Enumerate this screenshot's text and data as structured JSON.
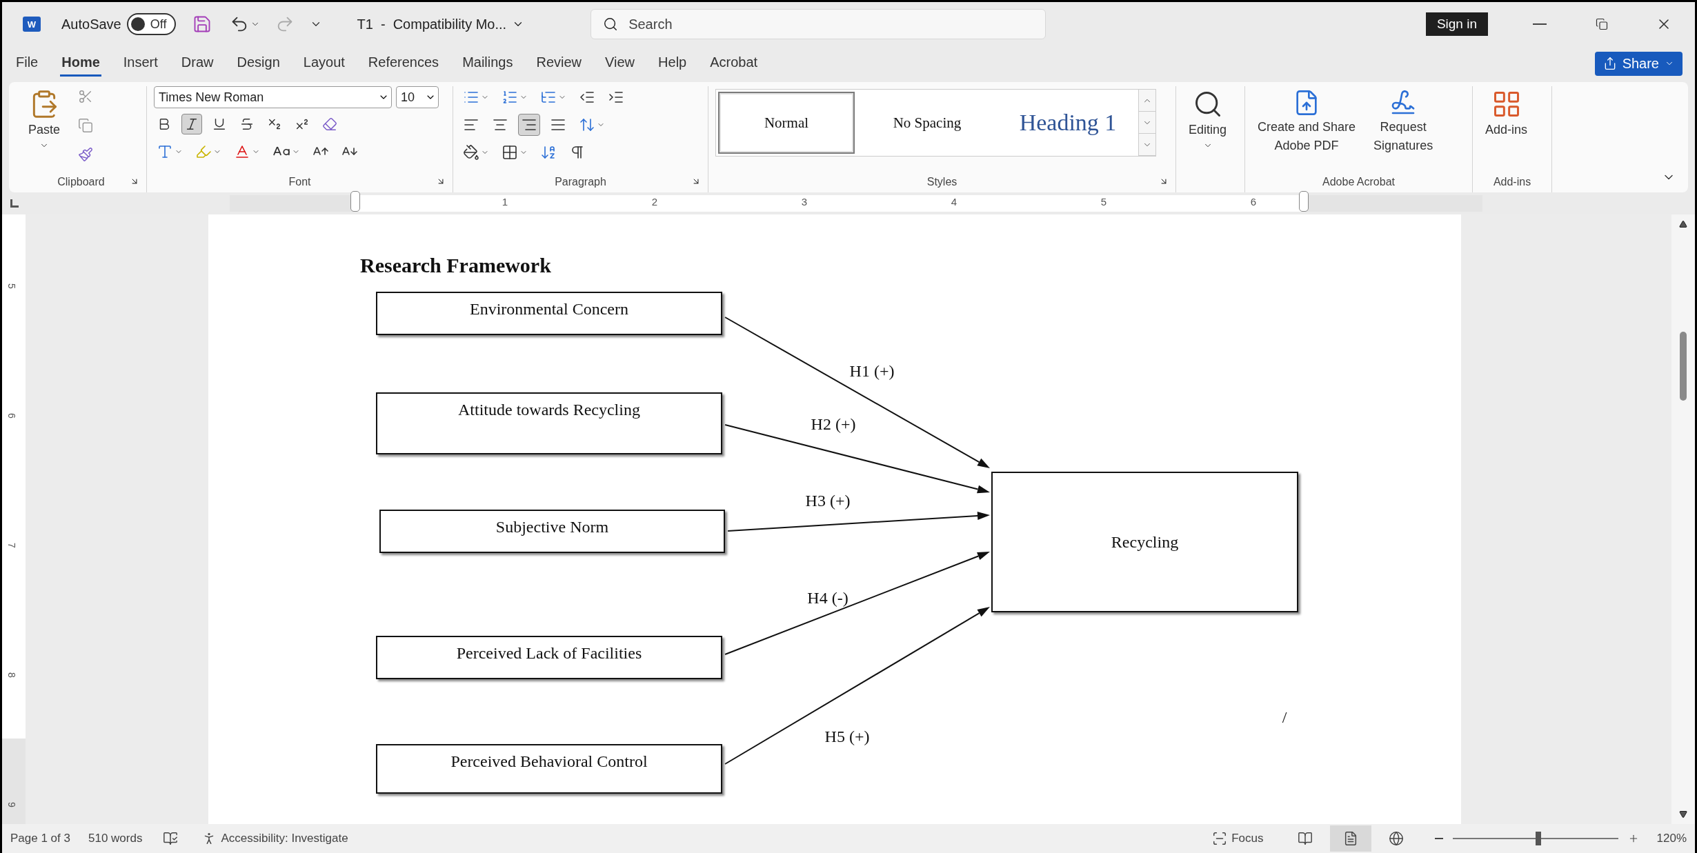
{
  "title_bar": {
    "app_logo_letter": "W",
    "autosave": {
      "label": "AutoSave",
      "state_text": "Off",
      "on": false
    },
    "document_title": "T1  -  Compatibility Mo...",
    "search": {
      "placeholder": "Search"
    },
    "sign_in": "Sign in"
  },
  "tabs": [
    {
      "label": "File",
      "selected": false
    },
    {
      "label": "Home",
      "selected": true
    },
    {
      "label": "Insert",
      "selected": false
    },
    {
      "label": "Draw",
      "selected": false
    },
    {
      "label": "Design",
      "selected": false
    },
    {
      "label": "Layout",
      "selected": false
    },
    {
      "label": "References",
      "selected": false
    },
    {
      "label": "Mailings",
      "selected": false
    },
    {
      "label": "Review",
      "selected": false
    },
    {
      "label": "View",
      "selected": false
    },
    {
      "label": "Help",
      "selected": false
    },
    {
      "label": "Acrobat",
      "selected": false
    }
  ],
  "share": "Share",
  "ribbon": {
    "clipboard": {
      "paste": "Paste",
      "label": "Clipboard"
    },
    "font": {
      "font_name": "Times New Roman",
      "font_size": "10",
      "label": "Font",
      "format_buttons": [
        {
          "kind": "bold",
          "pressed": false
        },
        {
          "kind": "italic",
          "pressed": true
        },
        {
          "kind": "underline",
          "pressed": false
        },
        {
          "kind": "strikethrough",
          "pressed": false
        },
        {
          "kind": "subscript",
          "pressed": false
        },
        {
          "kind": "superscript",
          "pressed": false
        }
      ]
    },
    "paragraph": {
      "label": "Paragraph",
      "align_buttons": [
        {
          "kind": "left",
          "pressed": false
        },
        {
          "kind": "center",
          "pressed": false
        },
        {
          "kind": "right",
          "pressed": true
        },
        {
          "kind": "justify",
          "pressed": false
        }
      ]
    },
    "styles": {
      "label": "Styles",
      "items": [
        {
          "label": "Normal",
          "kind": "normal",
          "selected": true
        },
        {
          "label": "No Spacing",
          "kind": "no_spacing",
          "selected": false
        },
        {
          "label": "Heading 1",
          "kind": "heading",
          "selected": false
        }
      ]
    },
    "editing": {
      "label": "Editing"
    },
    "adobe_acrobat": {
      "label": "Adobe Acrobat",
      "buttons": [
        {
          "kind": "pdf",
          "label_lines": [
            "Create and Share",
            "Adobe PDF"
          ]
        },
        {
          "kind": "signature",
          "label_lines": [
            "Request",
            "Signatures"
          ]
        }
      ]
    },
    "add_ins": {
      "button": "Add-ins",
      "label": "Add-ins"
    }
  },
  "ruler": {
    "numbers": [
      "1",
      "2",
      "3",
      "4",
      "5",
      "6"
    ]
  },
  "vertical_ruler": {
    "numbers": [
      "5",
      "6",
      "7",
      "8",
      "9"
    ]
  },
  "document": {
    "heading": "Research Framework",
    "diagram": {
      "nodes": [
        {
          "label": "Environmental Concern",
          "kind": "factor"
        },
        {
          "label": "Attitude towards Recycling",
          "kind": "factor"
        },
        {
          "label": "Subjective Norm",
          "kind": "factor"
        },
        {
          "label": "Perceived Lack of Facilities",
          "kind": "factor"
        },
        {
          "label": "Perceived Behavioral Control",
          "kind": "factor"
        },
        {
          "label": "Recycling",
          "kind": "outcome"
        }
      ],
      "hypotheses": [
        {
          "label": "H1 (+)"
        },
        {
          "label": "H2 (+)"
        },
        {
          "label": "H3 (+)"
        },
        {
          "label": "H4 (-)"
        },
        {
          "label": "H5 (+)"
        }
      ],
      "stray_mark": "/"
    }
  },
  "status_bar": {
    "page": "Page 1 of 3",
    "words": "510 words",
    "accessibility": "Accessibility: Investigate",
    "focus": "Focus",
    "views": [
      {
        "kind": "read",
        "selected": false
      },
      {
        "kind": "print",
        "selected": true
      },
      {
        "kind": "web",
        "selected": false
      }
    ],
    "zoom": {
      "level": 0.52,
      "reading": "120%"
    }
  }
}
